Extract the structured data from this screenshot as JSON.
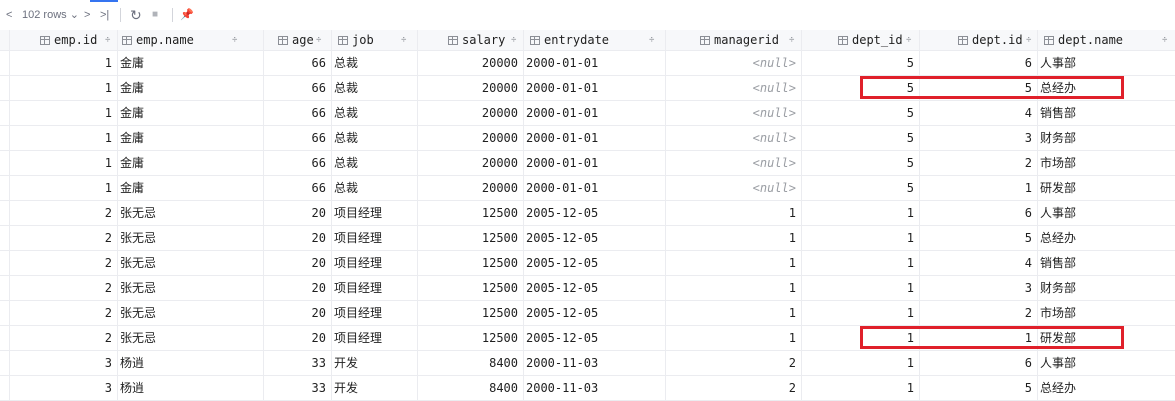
{
  "toolbar": {
    "rows_label": "102 rows",
    "rows_caret": "⌄",
    "nav_first": "<",
    "nav_next": ">",
    "nav_last": ">|",
    "refresh": "↻",
    "stop": "■",
    "pin": "📌"
  },
  "columns": [
    {
      "label": "emp.id",
      "sort": "÷"
    },
    {
      "label": "emp.name",
      "sort": "÷"
    },
    {
      "label": "age",
      "sort": "÷"
    },
    {
      "label": "job",
      "sort": "÷"
    },
    {
      "label": "salary",
      "sort": "÷"
    },
    {
      "label": "entrydate",
      "sort": "÷"
    },
    {
      "label": "managerid",
      "sort": "÷"
    },
    {
      "label": "dept_id",
      "sort": "÷"
    },
    {
      "label": "dept.id",
      "sort": "÷"
    },
    {
      "label": "dept.name",
      "sort": "÷"
    }
  ],
  "rows": [
    [
      "1",
      "金庸",
      "66",
      "总裁",
      "20000",
      "2000-01-01",
      "<null>",
      "5",
      "6",
      "人事部"
    ],
    [
      "1",
      "金庸",
      "66",
      "总裁",
      "20000",
      "2000-01-01",
      "<null>",
      "5",
      "5",
      "总经办"
    ],
    [
      "1",
      "金庸",
      "66",
      "总裁",
      "20000",
      "2000-01-01",
      "<null>",
      "5",
      "4",
      "销售部"
    ],
    [
      "1",
      "金庸",
      "66",
      "总裁",
      "20000",
      "2000-01-01",
      "<null>",
      "5",
      "3",
      "财务部"
    ],
    [
      "1",
      "金庸",
      "66",
      "总裁",
      "20000",
      "2000-01-01",
      "<null>",
      "5",
      "2",
      "市场部"
    ],
    [
      "1",
      "金庸",
      "66",
      "总裁",
      "20000",
      "2000-01-01",
      "<null>",
      "5",
      "1",
      "研发部"
    ],
    [
      "2",
      "张无忌",
      "20",
      "项目经理",
      "12500",
      "2005-12-05",
      "1",
      "1",
      "6",
      "人事部"
    ],
    [
      "2",
      "张无忌",
      "20",
      "项目经理",
      "12500",
      "2005-12-05",
      "1",
      "1",
      "5",
      "总经办"
    ],
    [
      "2",
      "张无忌",
      "20",
      "项目经理",
      "12500",
      "2005-12-05",
      "1",
      "1",
      "4",
      "销售部"
    ],
    [
      "2",
      "张无忌",
      "20",
      "项目经理",
      "12500",
      "2005-12-05",
      "1",
      "1",
      "3",
      "财务部"
    ],
    [
      "2",
      "张无忌",
      "20",
      "项目经理",
      "12500",
      "2005-12-05",
      "1",
      "1",
      "2",
      "市场部"
    ],
    [
      "2",
      "张无忌",
      "20",
      "项目经理",
      "12500",
      "2005-12-05",
      "1",
      "1",
      "1",
      "研发部"
    ],
    [
      "3",
      "杨逍",
      "33",
      "开发",
      "8400",
      "2000-11-03",
      "2",
      "1",
      "6",
      "人事部"
    ],
    [
      "3",
      "杨逍",
      "33",
      "开发",
      "8400",
      "2000-11-03",
      "2",
      "1",
      "5",
      "总经办"
    ]
  ],
  "highlight_rows": [
    1,
    11
  ],
  "colors": {
    "highlight": "#e0202a",
    "null_text": "#9a9da3"
  }
}
